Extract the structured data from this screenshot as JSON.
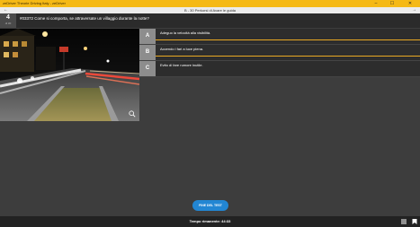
{
  "titlebar": {
    "title": "zeDriver Theorie Driving Italy - zeDriver",
    "minimize": "–",
    "maximize": "☐",
    "close": "✕"
  },
  "navbar": {
    "back": "←",
    "title": "B - 30 Perkorsi di Avare le guida",
    "forward": "→"
  },
  "question": {
    "number": "4",
    "sub": "di 30",
    "text": "#03372 Come si comporta, se attraversate un villaggio durante la notte?"
  },
  "answers": [
    {
      "letter": "A",
      "text": "Adeguo la velocità alla visibilità."
    },
    {
      "letter": "B",
      "text": "Accendo i fari a luce piena."
    },
    {
      "letter": "C",
      "text": "Evito di fare rumore inutile."
    }
  ],
  "finish_button": "FINE DEL TEST",
  "status": {
    "timer": "Tempo rimanente: 44:33"
  },
  "icons": {
    "zoom": "zoom-icon",
    "list": "list-icon",
    "bookmark": "bookmark-icon"
  },
  "colors": {
    "accent": "#f5b915",
    "primary": "#2286d3",
    "answer_line": "#e9a923"
  }
}
